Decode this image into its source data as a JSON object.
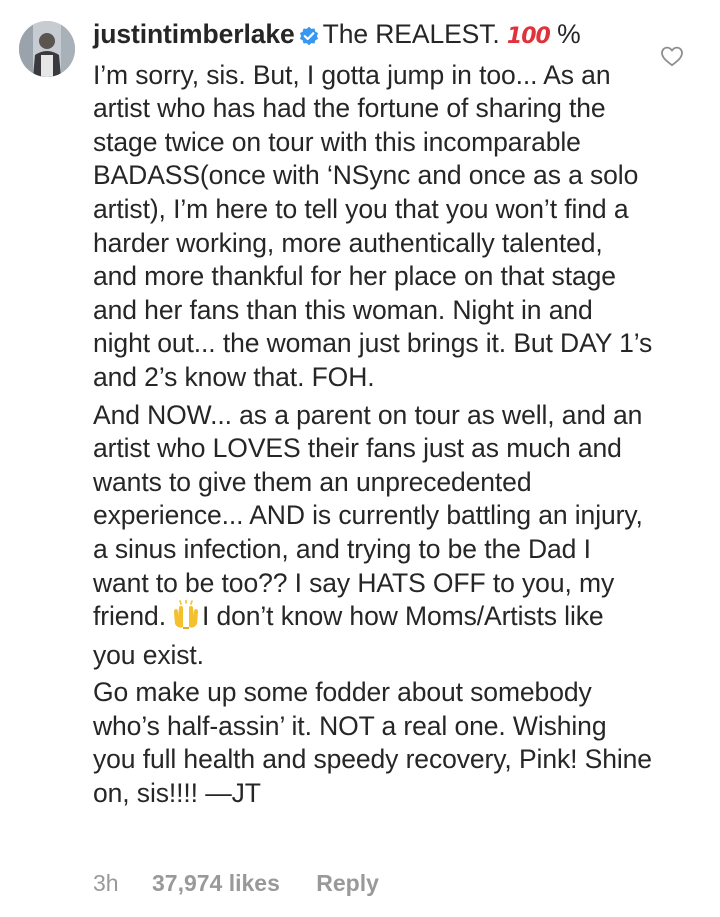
{
  "comment": {
    "username": "justintimberlake",
    "verified": true,
    "first_line_text": "The REALEST.",
    "first_line_emoji": "100",
    "first_line_suffix": "%",
    "para1": "I’m sorry, sis. But, I gotta jump in too... As an artist who has had the fortune of sharing the stage twice on tour with this incomparable BADASS(once with ‘NSync and once as a solo artist), I’m here to tell you that you won’t find a harder working, more authentically talented, and more thankful for her place on that stage and her fans than this woman. Night in and night out... the woman just brings it. But DAY 1’s and 2’s know that. FOH.",
    "para2_before_emoji": "And NOW... as a parent on tour as well, and an artist who LOVES their fans just as much and wants to give them an unprecedented experience... AND is currently battling an injury, a sinus infection, and trying to be the Dad I want to be too?? I say HATS OFF to you, my friend.",
    "para2_after_emoji": "I don’t know how Moms/Artists like you exist.",
    "para3": "Go make up some fodder about somebody who’s half-assin’ it. NOT a real one. Wishing you full health and speedy recovery, Pink! Shine on, sis!!!! —JT"
  },
  "meta": {
    "time": "3h",
    "likes": "37,974 likes",
    "reply": "Reply"
  },
  "icons": {
    "avatar": "profile-photo",
    "verified": "verified-badge-icon",
    "emoji_100": "hundred-points-emoji",
    "emoji_hands": "raising-hands-emoji",
    "like": "heart-outline-icon"
  },
  "colors": {
    "text": "#262626",
    "muted": "#999999",
    "verified": "#3897f0",
    "emoji_red": "#e0323a",
    "hands_yellow": "#f4c02e"
  }
}
